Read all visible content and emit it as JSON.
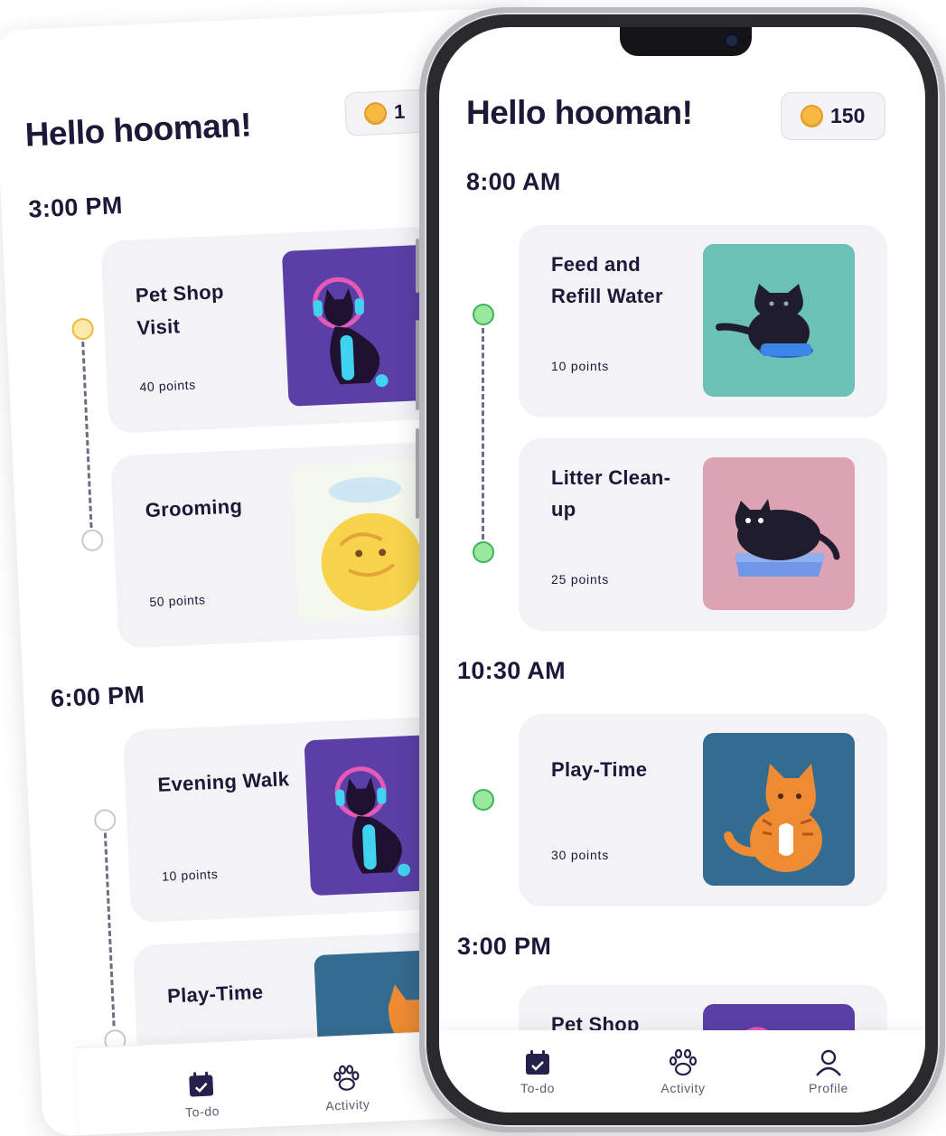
{
  "back_screen": {
    "greeting": "Hello hooman!",
    "coins": "1",
    "sections": [
      {
        "time": "3:00 PM",
        "tasks": [
          {
            "title": "Pet Shop Visit",
            "points": "40 points",
            "image": "cat-with-headphones"
          },
          {
            "title": "Grooming",
            "points": "50 points",
            "image": "cat-in-bath"
          }
        ]
      },
      {
        "time": "6:00 PM",
        "tasks": [
          {
            "title": "Evening Walk",
            "points": "10 points",
            "image": "cat-with-headphones"
          },
          {
            "title": "Play-Time",
            "points": "",
            "image": "orange-cat"
          }
        ]
      }
    ],
    "tabs": [
      {
        "label": "To-do",
        "icon": "calendar-check-icon"
      },
      {
        "label": "Activity",
        "icon": "paw-icon"
      }
    ]
  },
  "phone": {
    "greeting": "Hello hooman!",
    "coins": "150",
    "sections": [
      {
        "time": "8:00 AM",
        "tasks": [
          {
            "title": "Feed and Refill Water",
            "points": "10 points",
            "image": "black-cat-at-bowl"
          },
          {
            "title": "Litter Clean-up",
            "points": "25 points",
            "image": "black-cat-in-litter-box"
          }
        ]
      },
      {
        "time": "10:30 AM",
        "tasks": [
          {
            "title": "Play-Time",
            "points": "30 points",
            "image": "orange-cat"
          }
        ]
      },
      {
        "time": "3:00 PM",
        "tasks": [
          {
            "title": "Pet Shop",
            "points": "",
            "image": "cat-with-headphones"
          }
        ]
      }
    ],
    "tabs": [
      {
        "label": "To-do",
        "icon": "calendar-check-icon",
        "active": true
      },
      {
        "label": "Activity",
        "icon": "paw-icon",
        "active": false
      },
      {
        "label": "Profile",
        "icon": "user-icon",
        "active": false
      }
    ]
  },
  "colors": {
    "text": "#1c1838",
    "card": "#f3f3f5",
    "coin": "#f6b941",
    "node_done": "#9ae79e",
    "node_current": "#fde9a9",
    "art_purple": "#5b3fa6",
    "art_teal": "#6cc1b6",
    "art_pink": "#dca3b5",
    "art_blue": "#346b90"
  }
}
